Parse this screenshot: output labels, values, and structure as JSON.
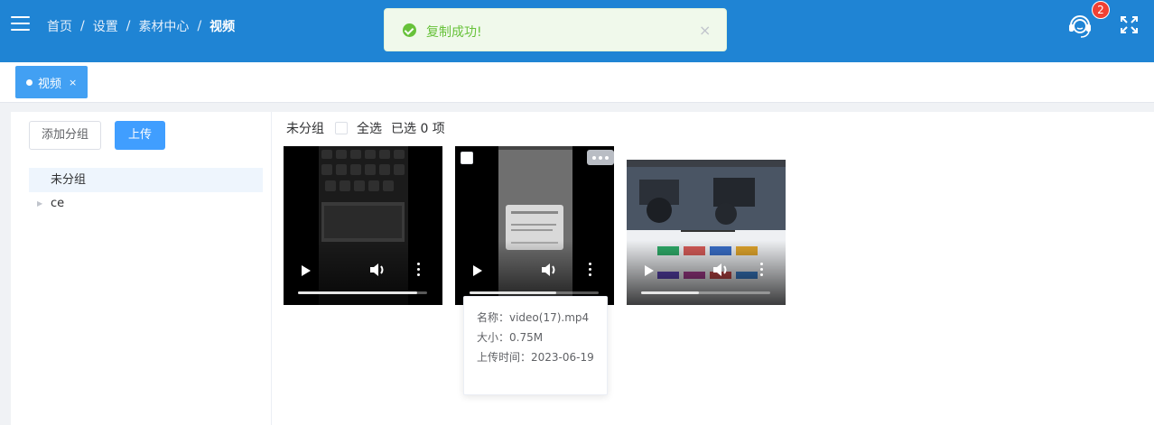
{
  "header": {
    "breadcrumb": [
      "首页",
      "设置",
      "素材中心",
      "视频"
    ],
    "separator": "/",
    "notification_count": "2"
  },
  "toast": {
    "message": "复制成功!",
    "close": "×",
    "type": "success",
    "color": "#67c23a"
  },
  "tags": {
    "active": {
      "label": "视频",
      "close": "×"
    }
  },
  "sidebar": {
    "add_group_label": "添加分组",
    "upload_label": "上传",
    "groups": [
      {
        "label": "未分组",
        "selected": true
      },
      {
        "label": "ce",
        "selected": false
      }
    ]
  },
  "toolbar": {
    "current_group": "未分组",
    "select_all_label": "全选",
    "selected_count_text": "已选 0 项"
  },
  "videos": [
    {
      "progress": 0.92
    },
    {
      "progress": 0.67
    },
    {
      "progress": 0.45
    }
  ],
  "tooltip": {
    "name": "名称：video(17).mp4",
    "size": "大小：0.75M",
    "upload_time": "上传时间：2023-06-19"
  },
  "colors": {
    "header": "#1f84d4",
    "tag_active": "#42a0f3",
    "primary_button": "#409eff",
    "badge": "#f04134"
  }
}
